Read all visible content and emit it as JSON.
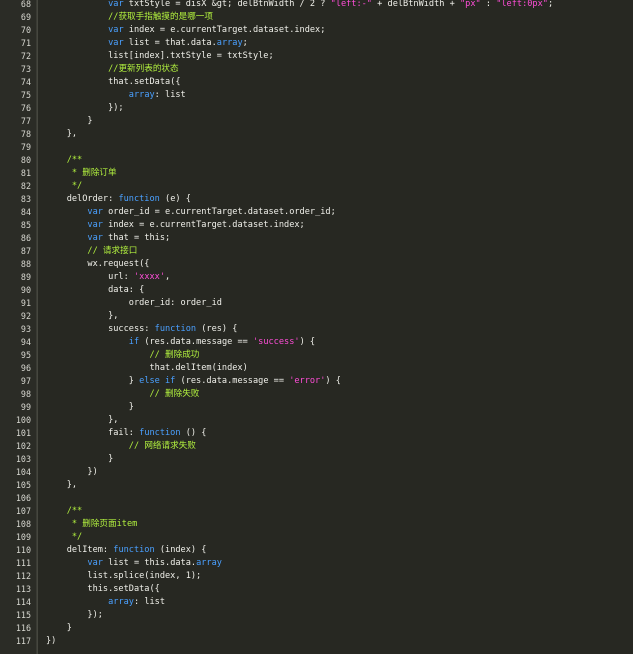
{
  "colors": {
    "background": "#272822",
    "keyword": "#4aa0ff",
    "string": "#ff4dd8",
    "comment": "#b3f23f",
    "plain": "#f0f0ea",
    "line_number": "#d7d7d0"
  },
  "lines": [
    {
      "n": "68",
      "tokens": [
        [
          "pl",
          "            "
        ],
        [
          "kw",
          "var"
        ],
        [
          "pl",
          " txtStyle = disX &gt; delBtnWidth / 2 ? "
        ],
        [
          "str",
          "\"left:-\""
        ],
        [
          "pl",
          " + delBtnWidth + "
        ],
        [
          "str",
          "\"px\""
        ],
        [
          "pl",
          " : "
        ],
        [
          "str",
          "\"left:0px\""
        ],
        [
          "pl",
          ";"
        ]
      ]
    },
    {
      "n": "69",
      "tokens": [
        [
          "pl",
          "            "
        ],
        [
          "cm",
          "//获取手指触摸的是哪一项"
        ]
      ]
    },
    {
      "n": "70",
      "tokens": [
        [
          "pl",
          "            "
        ],
        [
          "kw",
          "var"
        ],
        [
          "pl",
          " index = e.currentTarget.dataset.index;"
        ]
      ]
    },
    {
      "n": "71",
      "tokens": [
        [
          "pl",
          "            "
        ],
        [
          "kw",
          "var"
        ],
        [
          "pl",
          " list = that.data."
        ],
        [
          "kw",
          "array"
        ],
        [
          "pl",
          ";"
        ]
      ]
    },
    {
      "n": "72",
      "tokens": [
        [
          "pl",
          "            list[index].txtStyle = txtStyle;"
        ]
      ]
    },
    {
      "n": "73",
      "tokens": [
        [
          "pl",
          "            "
        ],
        [
          "cm",
          "//更新列表的状态"
        ]
      ]
    },
    {
      "n": "74",
      "tokens": [
        [
          "pl",
          "            that.setData({"
        ]
      ]
    },
    {
      "n": "75",
      "tokens": [
        [
          "pl",
          "                "
        ],
        [
          "kw",
          "array"
        ],
        [
          "pl",
          ": list"
        ]
      ]
    },
    {
      "n": "76",
      "tokens": [
        [
          "pl",
          "            });"
        ]
      ]
    },
    {
      "n": "77",
      "tokens": [
        [
          "pl",
          "        }"
        ]
      ]
    },
    {
      "n": "78",
      "tokens": [
        [
          "pl",
          "    },"
        ]
      ]
    },
    {
      "n": "79",
      "tokens": [
        [
          "pl",
          ""
        ]
      ]
    },
    {
      "n": "80",
      "tokens": [
        [
          "pl",
          "    "
        ],
        [
          "cm",
          "/**"
        ]
      ]
    },
    {
      "n": "81",
      "tokens": [
        [
          "pl",
          "     "
        ],
        [
          "cm",
          "* 删除订单"
        ]
      ]
    },
    {
      "n": "82",
      "tokens": [
        [
          "pl",
          "     "
        ],
        [
          "cm",
          "*/"
        ]
      ]
    },
    {
      "n": "83",
      "tokens": [
        [
          "pl",
          "    delOrder: "
        ],
        [
          "kw",
          "function"
        ],
        [
          "pl",
          " (e) {"
        ]
      ]
    },
    {
      "n": "84",
      "tokens": [
        [
          "pl",
          "        "
        ],
        [
          "kw",
          "var"
        ],
        [
          "pl",
          " order_id = e.currentTarget.dataset.order_id;"
        ]
      ]
    },
    {
      "n": "85",
      "tokens": [
        [
          "pl",
          "        "
        ],
        [
          "kw",
          "var"
        ],
        [
          "pl",
          " index = e.currentTarget.dataset.index;"
        ]
      ]
    },
    {
      "n": "86",
      "tokens": [
        [
          "pl",
          "        "
        ],
        [
          "kw",
          "var"
        ],
        [
          "pl",
          " that = this;"
        ]
      ]
    },
    {
      "n": "87",
      "tokens": [
        [
          "pl",
          "        "
        ],
        [
          "cm",
          "// 请求接口"
        ]
      ]
    },
    {
      "n": "88",
      "tokens": [
        [
          "pl",
          "        wx.request({"
        ]
      ]
    },
    {
      "n": "89",
      "tokens": [
        [
          "pl",
          "            url: "
        ],
        [
          "str",
          "'xxxx'"
        ],
        [
          "pl",
          ","
        ]
      ]
    },
    {
      "n": "90",
      "tokens": [
        [
          "pl",
          "            data: {"
        ]
      ]
    },
    {
      "n": "91",
      "tokens": [
        [
          "pl",
          "                order_id: order_id"
        ]
      ]
    },
    {
      "n": "92",
      "tokens": [
        [
          "pl",
          "            },"
        ]
      ]
    },
    {
      "n": "93",
      "tokens": [
        [
          "pl",
          "            success: "
        ],
        [
          "kw",
          "function"
        ],
        [
          "pl",
          " (res) {"
        ]
      ]
    },
    {
      "n": "94",
      "tokens": [
        [
          "pl",
          "                "
        ],
        [
          "kw",
          "if"
        ],
        [
          "pl",
          " (res.data.message == "
        ],
        [
          "str",
          "'success'"
        ],
        [
          "pl",
          ") {"
        ]
      ]
    },
    {
      "n": "95",
      "tokens": [
        [
          "pl",
          "                    "
        ],
        [
          "cm",
          "// 删除成功"
        ]
      ]
    },
    {
      "n": "96",
      "tokens": [
        [
          "pl",
          "                    that.delItem(index)"
        ]
      ]
    },
    {
      "n": "97",
      "tokens": [
        [
          "pl",
          "                } "
        ],
        [
          "kw",
          "else if"
        ],
        [
          "pl",
          " (res.data.message == "
        ],
        [
          "str",
          "'error'"
        ],
        [
          "pl",
          ") {"
        ]
      ]
    },
    {
      "n": "98",
      "tokens": [
        [
          "pl",
          "                    "
        ],
        [
          "cm",
          "// 删除失败"
        ]
      ]
    },
    {
      "n": "99",
      "tokens": [
        [
          "pl",
          "                }"
        ]
      ]
    },
    {
      "n": "100",
      "tokens": [
        [
          "pl",
          "            },"
        ]
      ]
    },
    {
      "n": "101",
      "tokens": [
        [
          "pl",
          "            fail: "
        ],
        [
          "kw",
          "function"
        ],
        [
          "pl",
          " () {"
        ]
      ]
    },
    {
      "n": "102",
      "tokens": [
        [
          "pl",
          "                "
        ],
        [
          "cm",
          "// 网络请求失败"
        ]
      ]
    },
    {
      "n": "103",
      "tokens": [
        [
          "pl",
          "            }"
        ]
      ]
    },
    {
      "n": "104",
      "tokens": [
        [
          "pl",
          "        })"
        ]
      ]
    },
    {
      "n": "105",
      "tokens": [
        [
          "pl",
          "    },"
        ]
      ]
    },
    {
      "n": "106",
      "tokens": [
        [
          "pl",
          ""
        ]
      ]
    },
    {
      "n": "107",
      "tokens": [
        [
          "pl",
          "    "
        ],
        [
          "cm",
          "/**"
        ]
      ]
    },
    {
      "n": "108",
      "tokens": [
        [
          "pl",
          "     "
        ],
        [
          "cm",
          "* 删除页面item"
        ]
      ]
    },
    {
      "n": "109",
      "tokens": [
        [
          "pl",
          "     "
        ],
        [
          "cm",
          "*/"
        ]
      ]
    },
    {
      "n": "110",
      "tokens": [
        [
          "pl",
          "    delItem: "
        ],
        [
          "kw",
          "function"
        ],
        [
          "pl",
          " (index) {"
        ]
      ]
    },
    {
      "n": "111",
      "tokens": [
        [
          "pl",
          "        "
        ],
        [
          "kw",
          "var"
        ],
        [
          "pl",
          " list = this.data."
        ],
        [
          "kw",
          "array"
        ]
      ]
    },
    {
      "n": "112",
      "tokens": [
        [
          "pl",
          "        list.splice(index, 1);"
        ]
      ]
    },
    {
      "n": "113",
      "tokens": [
        [
          "pl",
          "        this.setData({"
        ]
      ]
    },
    {
      "n": "114",
      "tokens": [
        [
          "pl",
          "            "
        ],
        [
          "kw",
          "array"
        ],
        [
          "pl",
          ": list"
        ]
      ]
    },
    {
      "n": "115",
      "tokens": [
        [
          "pl",
          "        });"
        ]
      ]
    },
    {
      "n": "116",
      "tokens": [
        [
          "pl",
          "    }"
        ]
      ]
    },
    {
      "n": "117",
      "tokens": [
        [
          "pl",
          "})"
        ]
      ]
    }
  ]
}
